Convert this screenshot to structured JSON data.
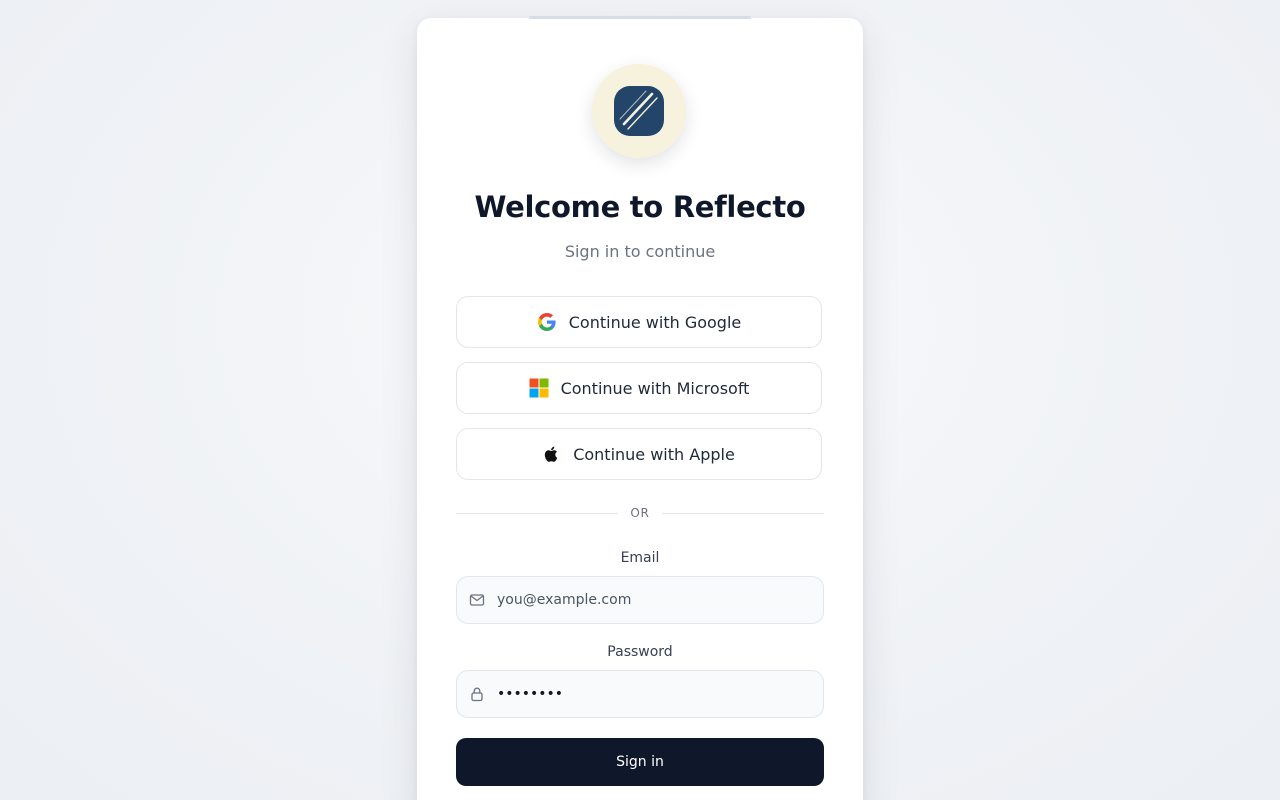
{
  "title": "Welcome to Reflecto",
  "subtitle": "Sign in to continue",
  "sso": {
    "google_label": "Continue with Google",
    "microsoft_label": "Continue with Microsoft",
    "apple_label": "Continue with Apple"
  },
  "divider_text": "OR",
  "email": {
    "label": "Email",
    "placeholder": "you@example.com",
    "value": ""
  },
  "password": {
    "label": "Password",
    "value": "••••••••"
  },
  "signin_label": "Sign in",
  "colors": {
    "primary": "#0f172a",
    "logo_bg": "#f7f2dd",
    "logo_mark": "#23456a"
  },
  "icons": {
    "logo": "reflecto-logo-icon",
    "google": "google-icon",
    "microsoft": "microsoft-icon",
    "apple": "apple-icon",
    "email": "mail-icon",
    "password": "lock-icon"
  }
}
